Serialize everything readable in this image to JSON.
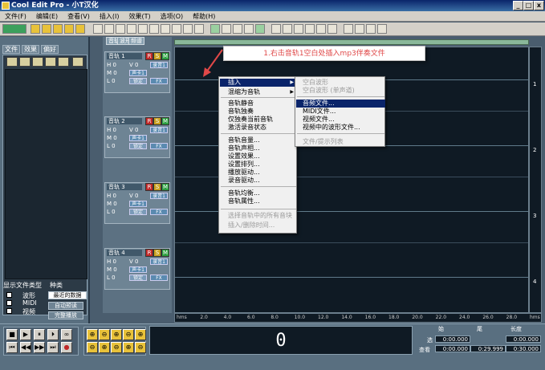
{
  "window": {
    "title": "Cool Edit Pro  - 小T汉化",
    "min": "_",
    "max": "□",
    "close": "x"
  },
  "menu": [
    "文件(F)",
    "编辑(E)",
    "查看(V)",
    "插入(I)",
    "效果(T)",
    "选项(O)",
    "帮助(H)"
  ],
  "left_panel": {
    "tabs": [
      "文件",
      "效果",
      "偏好"
    ],
    "show_type_label": "显示文件类型",
    "sort_label": "种类",
    "types": [
      "波形",
      "MIDI",
      "视频"
    ],
    "sort_select": "最近的数据",
    "buttons": [
      "自动预读",
      "完整播放"
    ]
  },
  "track_header_tabs": [
    "音轨",
    "波形",
    "频谱"
  ],
  "tracks": [
    {
      "name": "音轨 1",
      "v": "V 0",
      "in": "录音1",
      "out": "声卡1",
      "lock": "锁定",
      "fx": "FX"
    },
    {
      "name": "音轨 2",
      "v": "V 0",
      "in": "录音1",
      "out": "声卡1",
      "lock": "锁定",
      "fx": "FX"
    },
    {
      "name": "音轨 3",
      "v": "V 0",
      "in": "录音1",
      "out": "声卡1",
      "lock": "锁定",
      "fx": "FX"
    },
    {
      "name": "音轨 4",
      "v": "V 0",
      "in": "录音1",
      "out": "声卡1",
      "lock": "锁定",
      "fx": "FX"
    }
  ],
  "track_row_labels": {
    "h": "H 0",
    "l": "L 0",
    "m": "M 0"
  },
  "annotation": "1.右击音轨1空白处插入mp3伴奏文件",
  "context_menu": [
    {
      "label": "插入",
      "highlight": true,
      "arrow": "▶"
    },
    {
      "label": "混缩为音轨",
      "arrow": "▶"
    },
    {
      "label": "音轨静音"
    },
    {
      "label": "音轨独奏"
    },
    {
      "label": "仅独奏当前音轨"
    },
    {
      "label": "激活录音状态"
    },
    {
      "label": "音轨音量..."
    },
    {
      "label": "音轨声相..."
    },
    {
      "label": "设置效果..."
    },
    {
      "label": "设置排列..."
    },
    {
      "label": "播放驱动..."
    },
    {
      "label": "录音驱动..."
    },
    {
      "label": "音轨均衡..."
    },
    {
      "label": "音轨属性..."
    },
    {
      "label": "选择音轨中的所有音块",
      "disabled": true
    },
    {
      "label": "插入/删除时间...",
      "disabled": true
    }
  ],
  "submenu": [
    {
      "label": "空白波形",
      "disabled": true
    },
    {
      "label": "空白波形 (单声道)",
      "disabled": true
    },
    {
      "label": "音频文件...",
      "highlight": true
    },
    {
      "label": "MIDI文件..."
    },
    {
      "label": "视频文件..."
    },
    {
      "label": "视频中的波形文件..."
    },
    {
      "label": "文件/提示列表",
      "disabled": true
    }
  ],
  "timeline_ticks": [
    "hms",
    "2.0",
    "4.0",
    "6.0",
    "8.0",
    "10.0",
    "12.0",
    "14.0",
    "16.0",
    "18.0",
    "20.0",
    "22.0",
    "24.0",
    "26.0",
    "28.0",
    "hms"
  ],
  "right_scale": [
    "1",
    "2",
    "3",
    "4"
  ],
  "time_display": "0",
  "selection": {
    "headers": [
      "始",
      "尾",
      "长度"
    ],
    "rows": [
      {
        "label": "选",
        "start": "0:00.000",
        "end": "",
        "length": "0:00.000"
      },
      {
        "label": "查看",
        "start": "0:00.000",
        "end": "0:29.999",
        "length": "0:30.000"
      }
    ]
  },
  "transport": [
    "■",
    "▶",
    "⏸",
    "⏵",
    "∞",
    "⏮",
    "◀◀",
    "▶▶",
    "⏭",
    "●"
  ],
  "zoom": [
    "⊕",
    "⊖",
    "⊕",
    "⊖",
    "⊕",
    "⊖",
    "⊕",
    "⊖",
    "⊕",
    "⊖"
  ]
}
